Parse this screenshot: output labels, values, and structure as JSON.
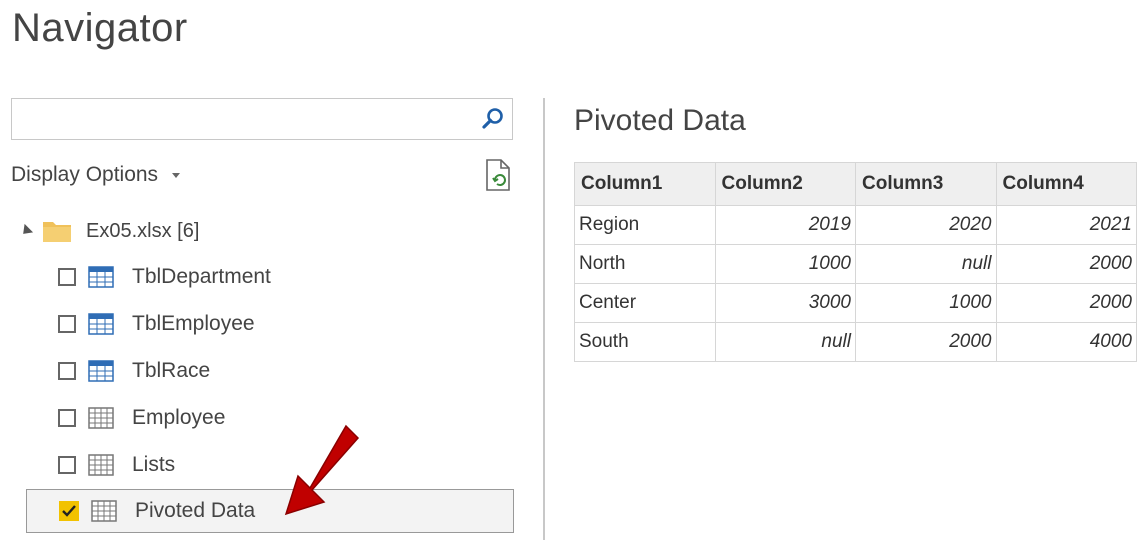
{
  "window": {
    "title": "Navigator"
  },
  "search": {
    "value": "",
    "placeholder": ""
  },
  "display_options": {
    "label": "Display Options"
  },
  "tree": {
    "root": {
      "label": "Ex05.xlsx [6]"
    },
    "items": [
      {
        "label": "TblDepartment",
        "checked": false,
        "icon": "table-icon"
      },
      {
        "label": "TblEmployee",
        "checked": false,
        "icon": "table-icon"
      },
      {
        "label": "TblRace",
        "checked": false,
        "icon": "table-icon"
      },
      {
        "label": "Employee",
        "checked": false,
        "icon": "sheet-icon"
      },
      {
        "label": "Lists",
        "checked": false,
        "icon": "sheet-icon"
      },
      {
        "label": "Pivoted Data",
        "checked": true,
        "icon": "sheet-icon"
      }
    ]
  },
  "preview": {
    "title": "Pivoted Data",
    "columns": [
      "Column1",
      "Column2",
      "Column3",
      "Column4"
    ],
    "rows": [
      [
        "Region",
        "2019",
        "2020",
        "2021"
      ],
      [
        "North",
        "1000",
        "null",
        "2000"
      ],
      [
        "Center",
        "3000",
        "1000",
        "2000"
      ],
      [
        "South",
        "null",
        "2000",
        "4000"
      ]
    ]
  },
  "colors": {
    "checkbox_checked": "#f2c200",
    "arrow": "#c00000",
    "table_header_bg": "#efefef"
  }
}
